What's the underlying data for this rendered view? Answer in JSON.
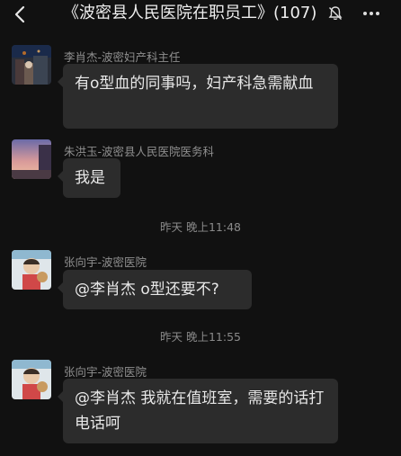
{
  "header": {
    "title": "《波密县人民医院在职员工》(107)",
    "back_icon": "chevron-left-icon",
    "mute_icon": "bell-off-icon",
    "more_icon": "more-dots-icon"
  },
  "messages": [
    {
      "sender": "李肖杰-波密妇产科主任",
      "text": "有o型血的同事吗，妇产科急需献血"
    },
    {
      "sender": "朱洪玉-波密县人民医院医务科",
      "text": "我是"
    },
    {
      "sender": "张向宇-波密医院",
      "text": "@李肖杰  o型还要不?"
    },
    {
      "sender": "张向宇-波密医院",
      "text": "@李肖杰  我就在值班室，需要的话打电话呵"
    }
  ],
  "timestamps": [
    "昨天 晚上11:48",
    "昨天 晚上11:55"
  ]
}
